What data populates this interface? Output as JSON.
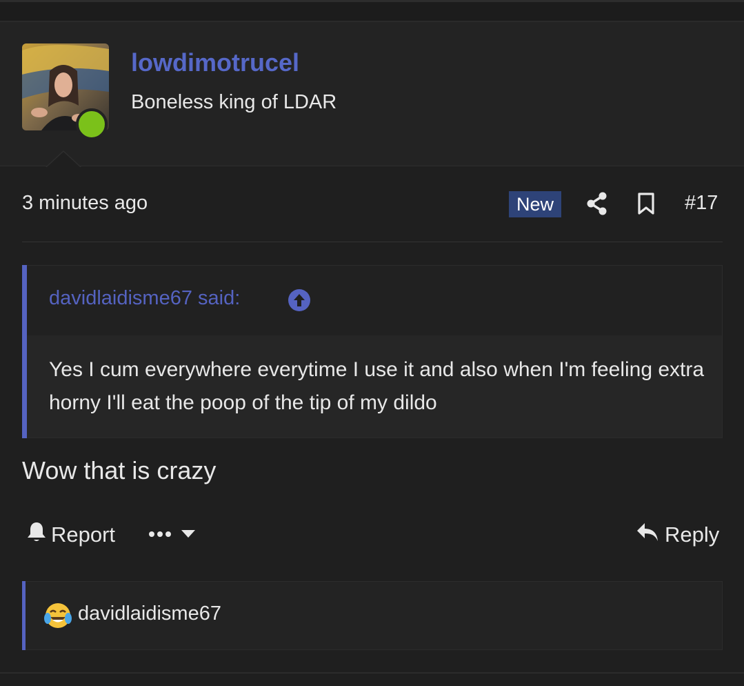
{
  "post": {
    "username": "lowdimotrucel",
    "user_title": "Boneless king of LDAR",
    "time": "3 minutes ago",
    "badge": "New",
    "number": "#17",
    "body": "Wow that is crazy"
  },
  "quote": {
    "author": "davidlaidisme67 said:",
    "text": "Yes I cum everywhere everytime I use it and also when I'm feeling extra horny I'll eat the poop of the tip of my dildo"
  },
  "actions": {
    "report_label": "Report",
    "reply_label": "Reply"
  },
  "reactions": {
    "emoji_icon": "face-with-tears-of-joy-icon",
    "user": "davidlaidisme67"
  },
  "colors": {
    "accent": "#5563c1",
    "username": "#5668c8",
    "online": "#7bc11a",
    "badge_bg": "#2e4378"
  }
}
